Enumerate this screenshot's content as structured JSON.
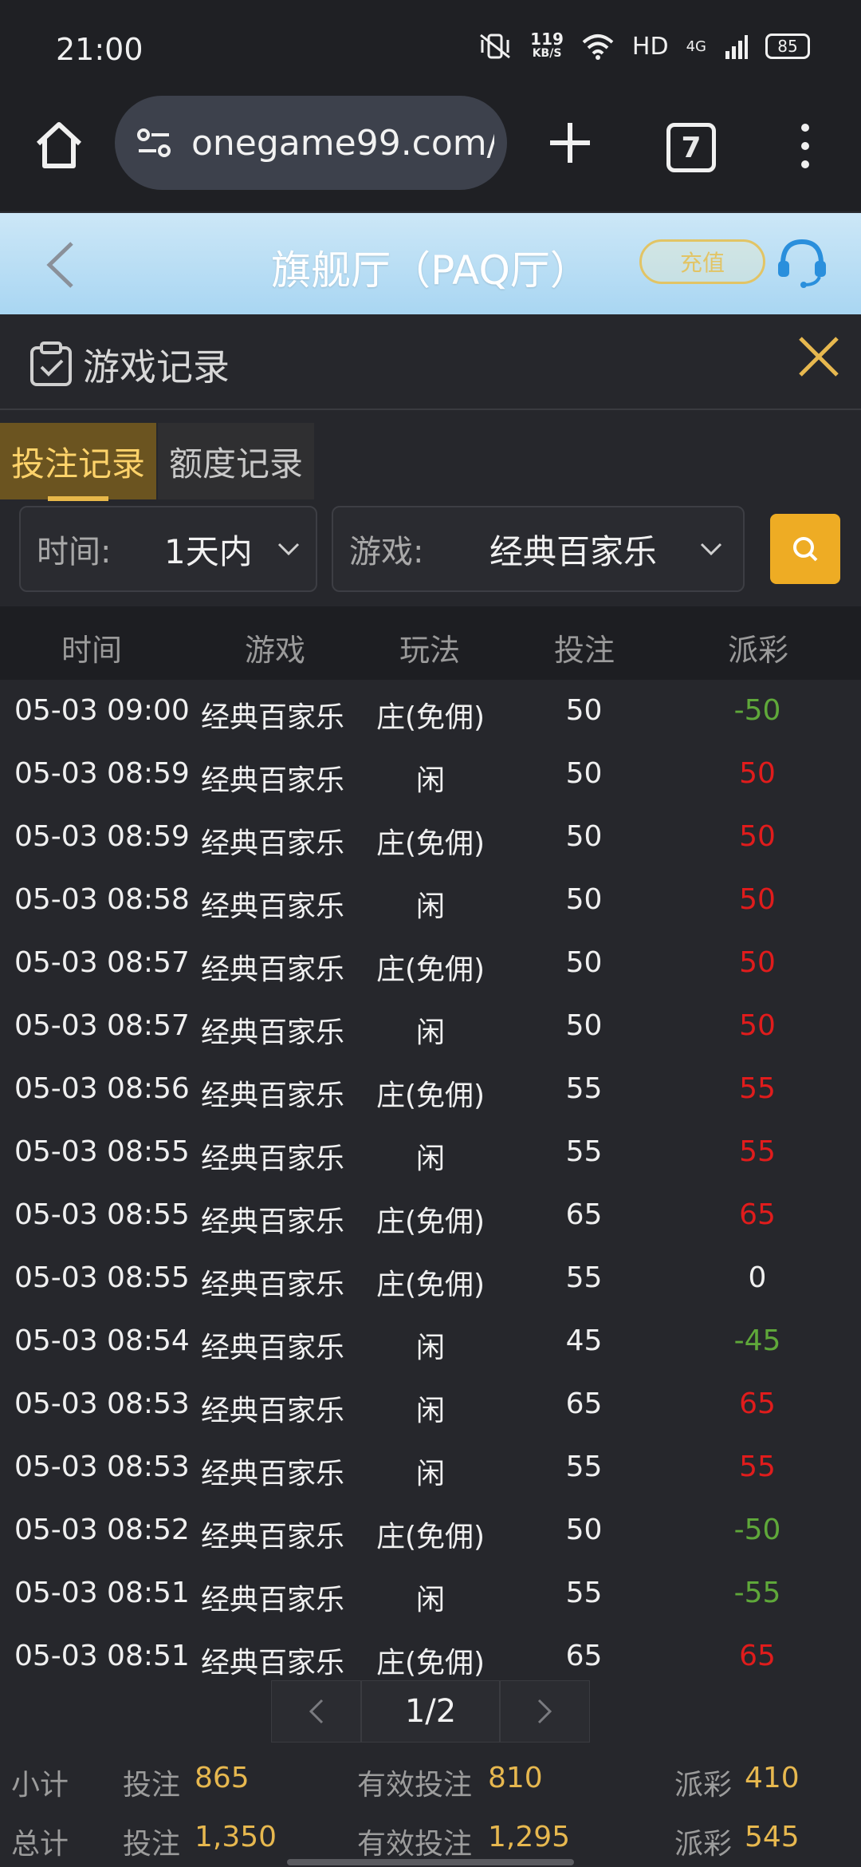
{
  "statusbar": {
    "time": "21:00",
    "speed_value": "119",
    "speed_unit": "KB/S",
    "hd": "HD",
    "network": "4G",
    "battery": "85"
  },
  "browser": {
    "url": "onegame99.com/",
    "tab_count": "7"
  },
  "header": {
    "title": "旗舰厅（PAQ厅）",
    "recharge_label": "充值"
  },
  "panel": {
    "title": "游戏记录"
  },
  "tabs": [
    {
      "label": "投注记录",
      "active": true
    },
    {
      "label": "额度记录",
      "active": false
    }
  ],
  "filters": {
    "time_label": "时间:",
    "time_value": "1天内",
    "game_label": "游戏:",
    "game_value": "经典百家乐"
  },
  "table": {
    "columns": [
      "时间",
      "游戏",
      "玩法",
      "投注",
      "派彩"
    ],
    "rows": [
      {
        "time": "05-03 09:00",
        "game": "经典百家乐",
        "play": "庄(免佣)",
        "bet": "50",
        "payout": "-50"
      },
      {
        "time": "05-03 08:59",
        "game": "经典百家乐",
        "play": "闲",
        "bet": "50",
        "payout": "50"
      },
      {
        "time": "05-03 08:59",
        "game": "经典百家乐",
        "play": "庄(免佣)",
        "bet": "50",
        "payout": "50"
      },
      {
        "time": "05-03 08:58",
        "game": "经典百家乐",
        "play": "闲",
        "bet": "50",
        "payout": "50"
      },
      {
        "time": "05-03 08:57",
        "game": "经典百家乐",
        "play": "庄(免佣)",
        "bet": "50",
        "payout": "50"
      },
      {
        "time": "05-03 08:57",
        "game": "经典百家乐",
        "play": "闲",
        "bet": "50",
        "payout": "50"
      },
      {
        "time": "05-03 08:56",
        "game": "经典百家乐",
        "play": "庄(免佣)",
        "bet": "55",
        "payout": "55"
      },
      {
        "time": "05-03 08:55",
        "game": "经典百家乐",
        "play": "闲",
        "bet": "55",
        "payout": "55"
      },
      {
        "time": "05-03 08:55",
        "game": "经典百家乐",
        "play": "庄(免佣)",
        "bet": "65",
        "payout": "65"
      },
      {
        "time": "05-03 08:55",
        "game": "经典百家乐",
        "play": "庄(免佣)",
        "bet": "55",
        "payout": "0"
      },
      {
        "time": "05-03 08:54",
        "game": "经典百家乐",
        "play": "闲",
        "bet": "45",
        "payout": "-45"
      },
      {
        "time": "05-03 08:53",
        "game": "经典百家乐",
        "play": "闲",
        "bet": "65",
        "payout": "65"
      },
      {
        "time": "05-03 08:53",
        "game": "经典百家乐",
        "play": "闲",
        "bet": "55",
        "payout": "55"
      },
      {
        "time": "05-03 08:52",
        "game": "经典百家乐",
        "play": "庄(免佣)",
        "bet": "50",
        "payout": "-50"
      },
      {
        "time": "05-03 08:51",
        "game": "经典百家乐",
        "play": "闲",
        "bet": "55",
        "payout": "-55"
      },
      {
        "time": "05-03 08:51",
        "game": "经典百家乐",
        "play": "庄(免佣)",
        "bet": "65",
        "payout": "65"
      }
    ]
  },
  "pagination": {
    "page": "1/2"
  },
  "subtotal": {
    "label": "小计",
    "bet_label": "投注",
    "bet": "865",
    "valid_label": "有效投注",
    "valid": "810",
    "payout_label": "派彩",
    "payout": "410"
  },
  "total": {
    "label": "总计",
    "bet_label": "投注",
    "bet": "1,350",
    "valid_label": "有效投注",
    "valid": "1,295",
    "payout_label": "派彩",
    "payout": "545"
  },
  "colors": {
    "win": "#e01c1c",
    "loss": "#5fa83a",
    "neutral": "#f0f0f0",
    "accent": "#e7b84f"
  }
}
